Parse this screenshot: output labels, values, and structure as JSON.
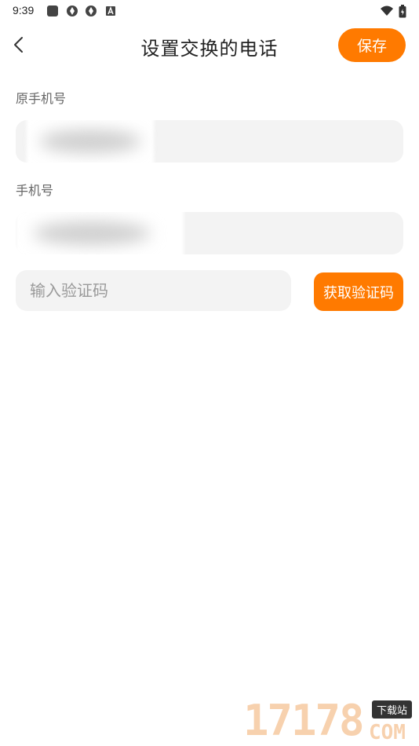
{
  "status_bar": {
    "time": "9:39",
    "icons": [
      "app-square-icon",
      "app-circle-icon",
      "app-circle-icon",
      "font-a-icon",
      "wifi-icon",
      "battery-icon"
    ]
  },
  "header": {
    "title": "设置交换的电话",
    "save_label": "保存",
    "back_icon": "chevron-left-icon"
  },
  "form": {
    "original_phone": {
      "label": "原手机号",
      "value": ""
    },
    "new_phone": {
      "label": "手机号",
      "value": ""
    },
    "verify_code": {
      "placeholder": "输入验证码",
      "value": ""
    },
    "get_code_label": "获取验证码"
  },
  "watermark": {
    "digits": "17178",
    "tag": "下载站",
    "suffix": "COM"
  },
  "colors": {
    "accent": "#ff7a00",
    "field_bg": "#f3f3f3",
    "label": "#666666",
    "placeholder": "#9a9a9a"
  }
}
